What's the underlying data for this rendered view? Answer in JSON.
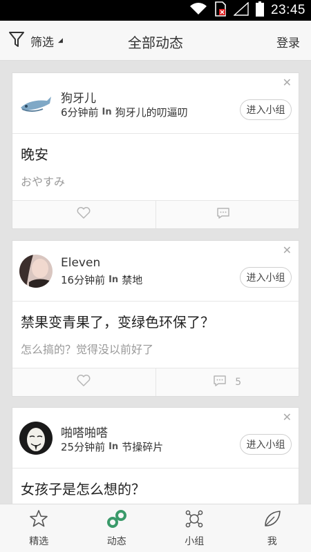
{
  "status_bar": {
    "time": "23:45",
    "icons": [
      "wifi-icon",
      "sim-off-icon",
      "signal-icon",
      "battery-icon"
    ]
  },
  "header": {
    "filter_label": "筛选",
    "title": "全部动态",
    "login_label": "登录"
  },
  "colors": {
    "accent_green": "#3a9a6a",
    "header_bg": "#f7f7f7",
    "page_bg": "#e3e3e3"
  },
  "cards": [
    {
      "user": "狗牙儿",
      "time": "6分钟前",
      "in_label": "In",
      "group": "狗牙儿的叨逼叨",
      "enter_label": "进入小组",
      "title": "晚安",
      "subtitle": "おやすみ",
      "comment_count": ""
    },
    {
      "user": "Eleven",
      "time": "16分钟前",
      "in_label": "In",
      "group": "禁地",
      "enter_label": "进入小组",
      "title": "禁果变青果了，变绿色环保了？",
      "subtitle": "怎么搞的？觉得没以前好了",
      "comment_count": "5"
    },
    {
      "user": "啪嗒啪嗒",
      "time": "25分钟前",
      "in_label": "In",
      "group": "节操碎片",
      "enter_label": "进入小组",
      "title": "女孩子是怎么想的？",
      "subtitle": "",
      "comment_count": ""
    }
  ],
  "bottom_nav": [
    {
      "label": "精选",
      "icon": "star-icon"
    },
    {
      "label": "动态",
      "icon": "chain-link-icon",
      "active": true
    },
    {
      "label": "小组",
      "icon": "group-network-icon"
    },
    {
      "label": "我",
      "icon": "leaf-icon"
    }
  ]
}
